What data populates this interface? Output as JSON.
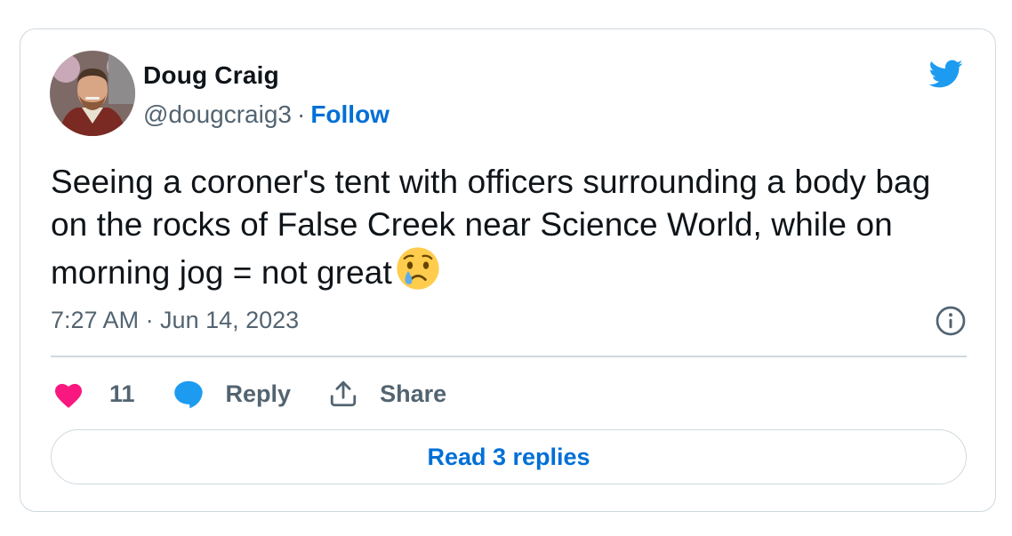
{
  "tweet": {
    "author": {
      "display_name": "Doug Craig",
      "handle": "@dougcraig3",
      "separator": "·",
      "follow_label": "Follow",
      "avatar_icon": "profile-photo"
    },
    "text": "Seeing a coroner's tent with officers surrounding a body bag on the rocks of False Creek near Science World, while on morning jog = not great",
    "emoji_icon": "crying-face-emoji",
    "timestamp": "7:27 AM · Jun 14, 2023",
    "actions": {
      "like_count": "11",
      "reply_label": "Reply",
      "share_label": "Share"
    },
    "read_replies_label": "Read 3 replies"
  },
  "colors": {
    "brand": "#1d9bf0",
    "link": "#006fd6",
    "like": "#f91880",
    "muted": "#536471",
    "border": "#cfd9de"
  }
}
